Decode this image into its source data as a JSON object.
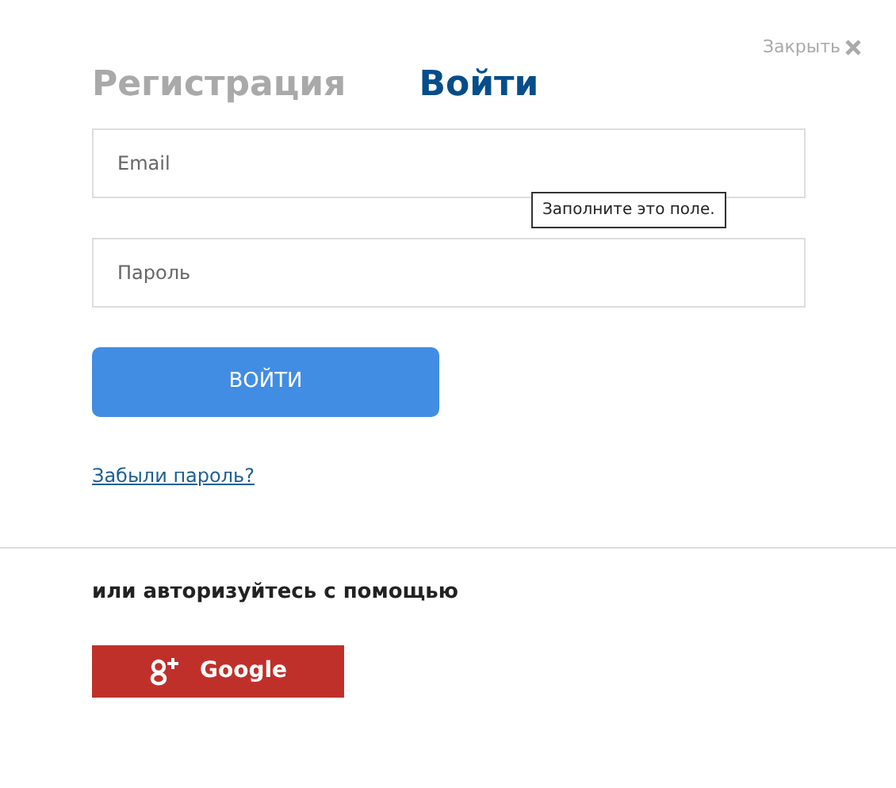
{
  "close": {
    "label": "Закрыть"
  },
  "tabs": [
    {
      "label": "Регистрация",
      "selected": false
    },
    {
      "label": "Войти",
      "selected": true
    }
  ],
  "fields": [
    {
      "placeholder": "Email"
    },
    {
      "placeholder": "Пароль"
    }
  ],
  "tooltip": "Заполните это поле.",
  "submit": "ВОЙТИ",
  "forgot": "Забыли пароль?",
  "social_heading": "или авторизуйтесь с помощью",
  "social_buttons": [
    {
      "label": "Google"
    }
  ]
}
